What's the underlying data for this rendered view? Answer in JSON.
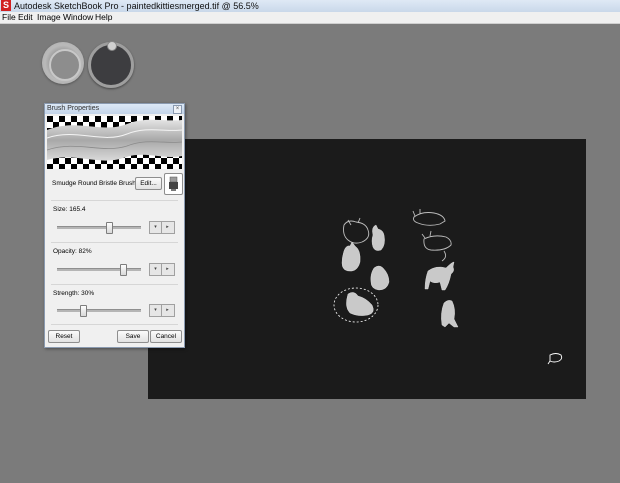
{
  "window": {
    "title": "Autodesk SketchBook Pro - paintedkittiesmerged.tif @ 56.5%",
    "app_icon_glyph": "S"
  },
  "menu": {
    "items": [
      "File",
      "Edit",
      "Image",
      "Window",
      "Help"
    ]
  },
  "brush_panel": {
    "title": "Brush Properties",
    "close_glyph": "×",
    "brush_name": "Smudge Round Bristle Brush",
    "edit_label": "Edit...",
    "size_label": "Size: 165.4",
    "size_fraction": 0.64,
    "opacity_label": "Opacity: 82%",
    "opacity_fraction": 0.82,
    "strength_label": "Strength: 30%",
    "strength_fraction": 0.3,
    "stepper_down": "▾",
    "stepper_up": "▸",
    "reset_label": "Reset",
    "save_label": "Save",
    "cancel_label": "Cancel"
  },
  "colors": {
    "canvas_bg": "#1b1b1b",
    "workspace_bg": "#7b7b7b",
    "kitten_fill": "#c9c9c9"
  }
}
